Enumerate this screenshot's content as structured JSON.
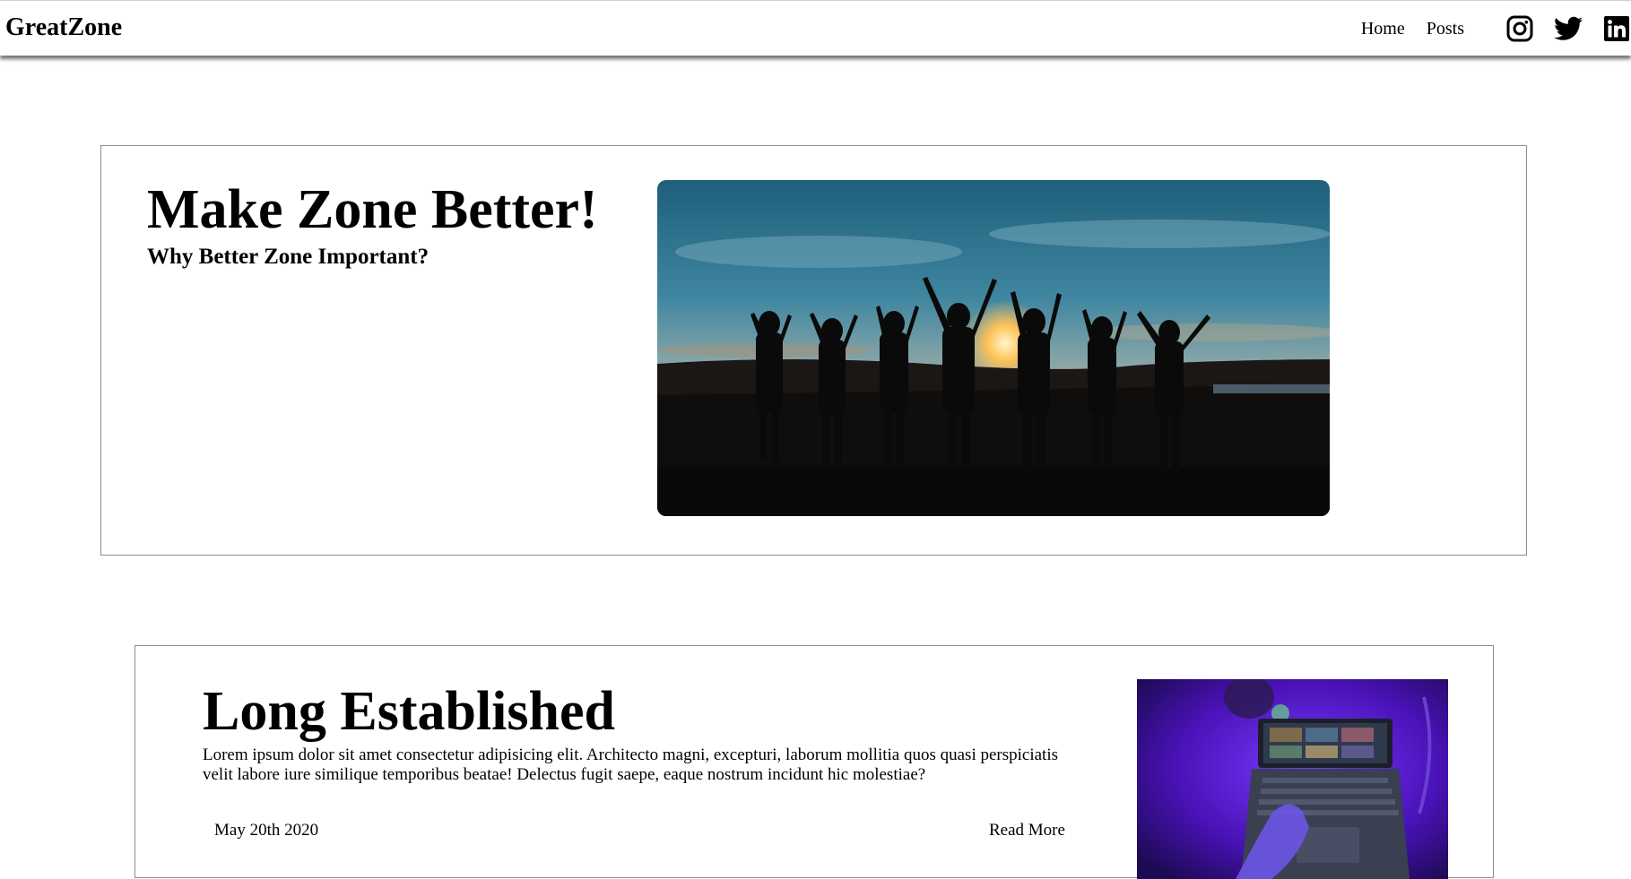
{
  "header": {
    "brand": "GreatZone",
    "nav": {
      "home": "Home",
      "posts": "Posts"
    },
    "social_icons": [
      "instagram-icon",
      "twitter-icon",
      "linkedin-icon"
    ]
  },
  "hero": {
    "title": "Make Zone Better!",
    "subtitle": "Why Better Zone Important?",
    "image_subject": "silhouettes of people raising hands at sunset"
  },
  "post": {
    "title": "Long Established",
    "body": "Lorem ipsum dolor sit amet consectetur adipisicing elit. Architecto magni, excepturi, laborum mollitia quos quasi perspiciatis velit labore iure similique temporibus beatae! Delectus fugit saepe, eaque nostrum incidunt hic molestiae?",
    "date": "May 20th 2020",
    "read_more": "Read More",
    "image_subject": "hand on laptop keyboard in purple light"
  },
  "colors": {
    "text": "#000000",
    "card_border": "#8c8c8c",
    "post_image_purple": "#5a1fc8"
  }
}
